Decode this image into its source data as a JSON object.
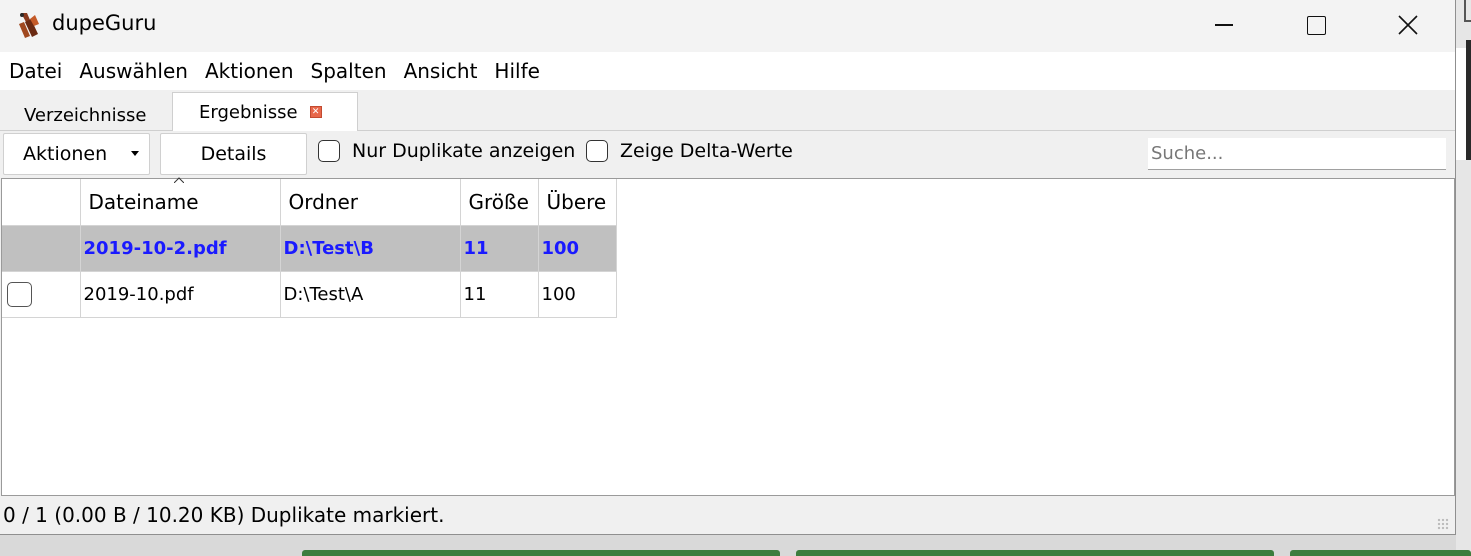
{
  "window": {
    "title": "dupeGuru",
    "app_icon": "dupeguru-logo-icon",
    "controls": [
      "minimize-icon",
      "maximize-icon",
      "close-icon"
    ]
  },
  "menu": [
    "Datei",
    "Auswählen",
    "Aktionen",
    "Spalten",
    "Ansicht",
    "Hilfe"
  ],
  "tabs": [
    {
      "label": "Verzeichnisse",
      "active": false
    },
    {
      "label": "Ergebnisse",
      "active": true,
      "closable": true
    }
  ],
  "toolbar": {
    "actions_label": "Aktionen",
    "details_label": "Details",
    "only_dupes_label": "Nur Duplikate anzeigen",
    "only_dupes_checked": false,
    "delta_label": "Zeige Delta-Werte",
    "delta_checked": false,
    "search_placeholder": "Suche...",
    "search_value": ""
  },
  "results": {
    "columns": [
      "",
      "Dateiname",
      "Ordner",
      "Größe",
      "Übere"
    ],
    "sorted_column": "Dateiname",
    "rows": [
      {
        "reference": true,
        "checked": null,
        "cells": [
          "2019-10-2.pdf",
          "D:\\Test\\B",
          "11",
          "100"
        ]
      },
      {
        "reference": false,
        "checked": false,
        "cells": [
          "2019-10.pdf",
          "D:\\Test\\A",
          "11",
          "100"
        ]
      }
    ]
  },
  "status": "0 / 1 (0.00 B / 10.20 KB) Duplikate markiert.",
  "colors": {
    "reference_row_bg": "#c0c0c0",
    "reference_row_text": "#1a1aff",
    "tab_close": "#e8674a"
  }
}
